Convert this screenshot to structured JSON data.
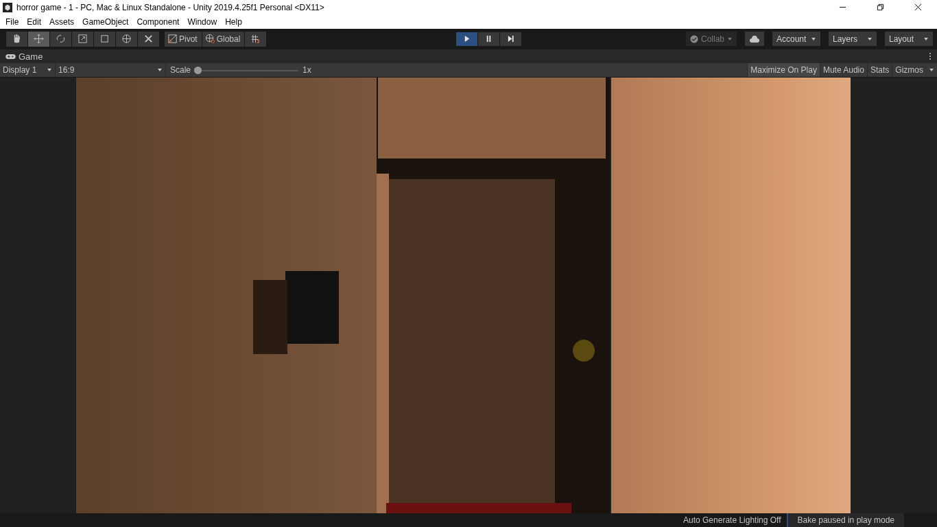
{
  "window": {
    "title": "horror game - 1 - PC, Mac & Linux Standalone - Unity 2019.4.25f1 Personal <DX11>"
  },
  "menu": [
    "File",
    "Edit",
    "Assets",
    "GameObject",
    "Component",
    "Window",
    "Help"
  ],
  "tools": [
    {
      "kind": "hand",
      "selected": false
    },
    {
      "kind": "move",
      "selected": true
    },
    {
      "kind": "rotate",
      "selected": false
    },
    {
      "kind": "scale",
      "selected": false
    },
    {
      "kind": "rect",
      "selected": false
    },
    {
      "kind": "transform",
      "selected": false
    },
    {
      "kind": "custom",
      "selected": false
    }
  ],
  "pivot": {
    "pivot": "Pivot",
    "space": "Global"
  },
  "playback": [
    {
      "kind": "play",
      "on": true
    },
    {
      "kind": "pause",
      "on": false
    },
    {
      "kind": "step",
      "on": false
    }
  ],
  "right_toolbar": {
    "collab": {
      "label": "Collab",
      "disabled": true
    },
    "account": "Account",
    "layers": "Layers",
    "layout": "Layout"
  },
  "game_tab": {
    "title": "Game"
  },
  "game_bar": {
    "display": "Display 1",
    "aspect": "16:9",
    "scale_label": "Scale",
    "scale": {
      "level": 0
    },
    "scale_reading": "1x",
    "toggles": [
      {
        "label": "Maximize On Play",
        "on": true
      },
      {
        "label": "Mute Audio",
        "on": false
      },
      {
        "label": "Stats",
        "on": false
      },
      {
        "label": "Gizmos",
        "on": false
      }
    ]
  },
  "status_bar": {
    "lighting": "Auto Generate Lighting Off",
    "bake": "Bake paused in play mode"
  }
}
